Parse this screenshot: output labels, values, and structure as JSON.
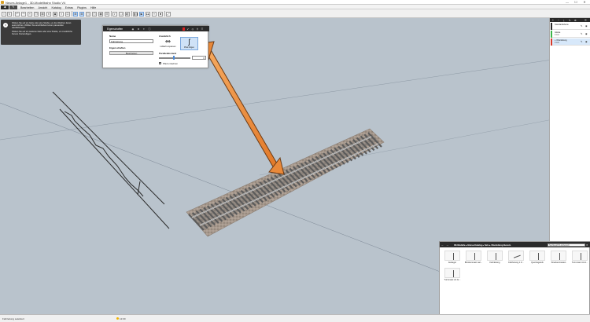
{
  "titlebar": {
    "title": "Neues Anlage1 - 3D-Modellbahn Studio V4",
    "minimize": "—",
    "maximize": "☐",
    "close": "✕"
  },
  "menubar": {
    "nav": [
      "◀",
      "✎"
    ],
    "items": [
      "Bearbeiten",
      "Ansicht",
      "Katalog",
      "Extras",
      "Plugins",
      "Hilfe"
    ]
  },
  "hint": {
    "line1": "Klicken Sie auf ein Gleis oder eine Straße, um die Weichen daran auszurichten. Wählen Sie anschließend einen passenden Handlebereich.",
    "line2": "Klicken Sie auf ein weiteres Gleis oder eine Straße, um zusätzliche Kurven hinzuzufügen."
  },
  "properties": {
    "title": "Eigenschaften",
    "name_label": "Name",
    "name_value": "Fahrleitung",
    "props_label": "Eigenschaften",
    "edit_button": "Bearbeiten",
    "aux_label": "Zusätzlich",
    "mode_adjust": "Lidläuft anpassen",
    "mode_curve": "Pfad folgen",
    "parallel_label": "Parallelabstand",
    "parallel_value": "0",
    "checkbox_label": "Pfad umkehren"
  },
  "layers": {
    "header_icons": [
      "+",
      "−",
      "⤓",
      "✎",
      "⚙",
      "☰"
    ],
    "items": [
      {
        "name": "Standardebene",
        "sub": "",
        "color": "#2a2a2a"
      },
      {
        "name": "Gleise",
        "sub": "0 mm",
        "color": "#3bb54a"
      },
      {
        "name": "+ Oberleitung",
        "sub": "0 mm",
        "color": "#d83a2a"
      }
    ]
  },
  "catalog": {
    "breadcrumb": "3D-Modelle ▸ Gleise-Katalog ▸ Sets ▸ Oberleitung Benutz.",
    "search_placeholder": "Suchbegriff (Lombert+K)",
    "close": "✕",
    "tiles": [
      "Ausleger",
      "Brückenmast vari...",
      "Fahrleitung",
      "Fahrleitung 1 Z...",
      "Quertragwerk",
      "Streckenmasten",
      "Turmmast mit A...",
      "Turmmast mit Ar..."
    ]
  },
  "status": {
    "text": "Fahrleitung selektiert",
    "time": "12:00"
  }
}
